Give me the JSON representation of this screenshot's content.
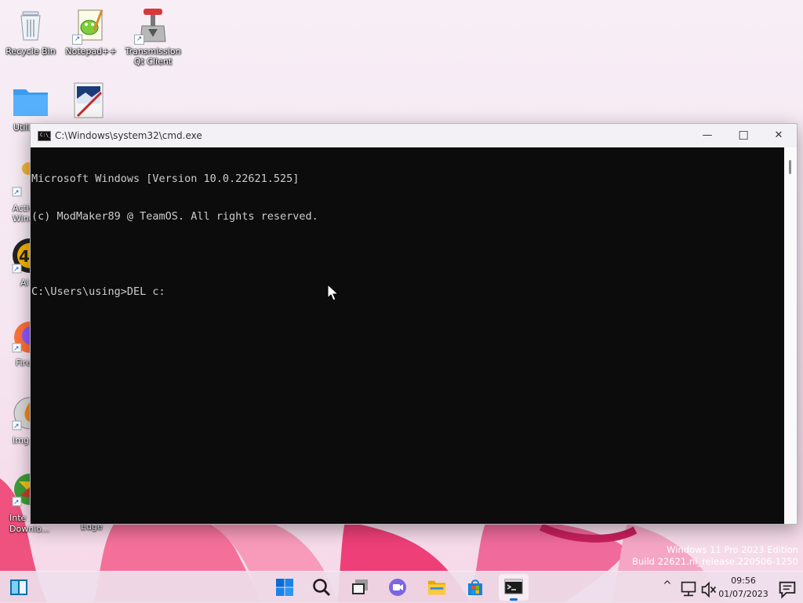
{
  "desktop": {
    "icons": [
      {
        "label": "Recycle Bin",
        "icon": "recycle-bin-icon"
      },
      {
        "label": "Notepad++",
        "icon": "notepad-plus-plus-icon"
      },
      {
        "label": "Transmission Qt Client",
        "icon": "transmission-icon"
      },
      {
        "label": "Utili",
        "icon": "folder-icon"
      },
      {
        "label": "",
        "icon": "image-app-icon"
      },
      {
        "label": "Activ Windo",
        "icon": "key-icon"
      },
      {
        "label": "Al",
        "icon": "aimp-icon"
      },
      {
        "label": "Fire",
        "icon": "firefox-icon"
      },
      {
        "label": "Img",
        "icon": "imgburn-icon"
      },
      {
        "label": "Inte Downlo...",
        "icon": "idm-icon"
      },
      {
        "label": "Edge",
        "icon": "edge-icon"
      }
    ]
  },
  "cmd_window": {
    "title": "C:\\Windows\\system32\\cmd.exe",
    "icon_glyph": "C:\\_",
    "minimize": "—",
    "maximize": "☐",
    "close": "✕",
    "lines": [
      "Microsoft Windows [Version 10.0.22621.525]",
      "(c) ModMaker89 @ TeamOS. All rights reserved.",
      "",
      "C:\\Users\\using>DEL c:"
    ]
  },
  "watermark": {
    "line1": "Windows 11 Pro 2023 Edition",
    "line2": "Build 22621.ni_release.220506-1250"
  },
  "taskbar": {
    "apps": [
      "widgets-icon",
      "start-icon",
      "search-icon",
      "task-view-icon",
      "teams-chat-icon",
      "file-explorer-icon",
      "microsoft-store-icon",
      "command-prompt-icon"
    ],
    "tray": {
      "chevron": "^",
      "time": "09:56",
      "date": "01/07/2023"
    }
  },
  "colors": {
    "console_bg": "#0c0c0c",
    "console_text": "#cccccc",
    "titlebar_bg": "#f3f1f5",
    "windows_blue": "#0a6cd6"
  }
}
